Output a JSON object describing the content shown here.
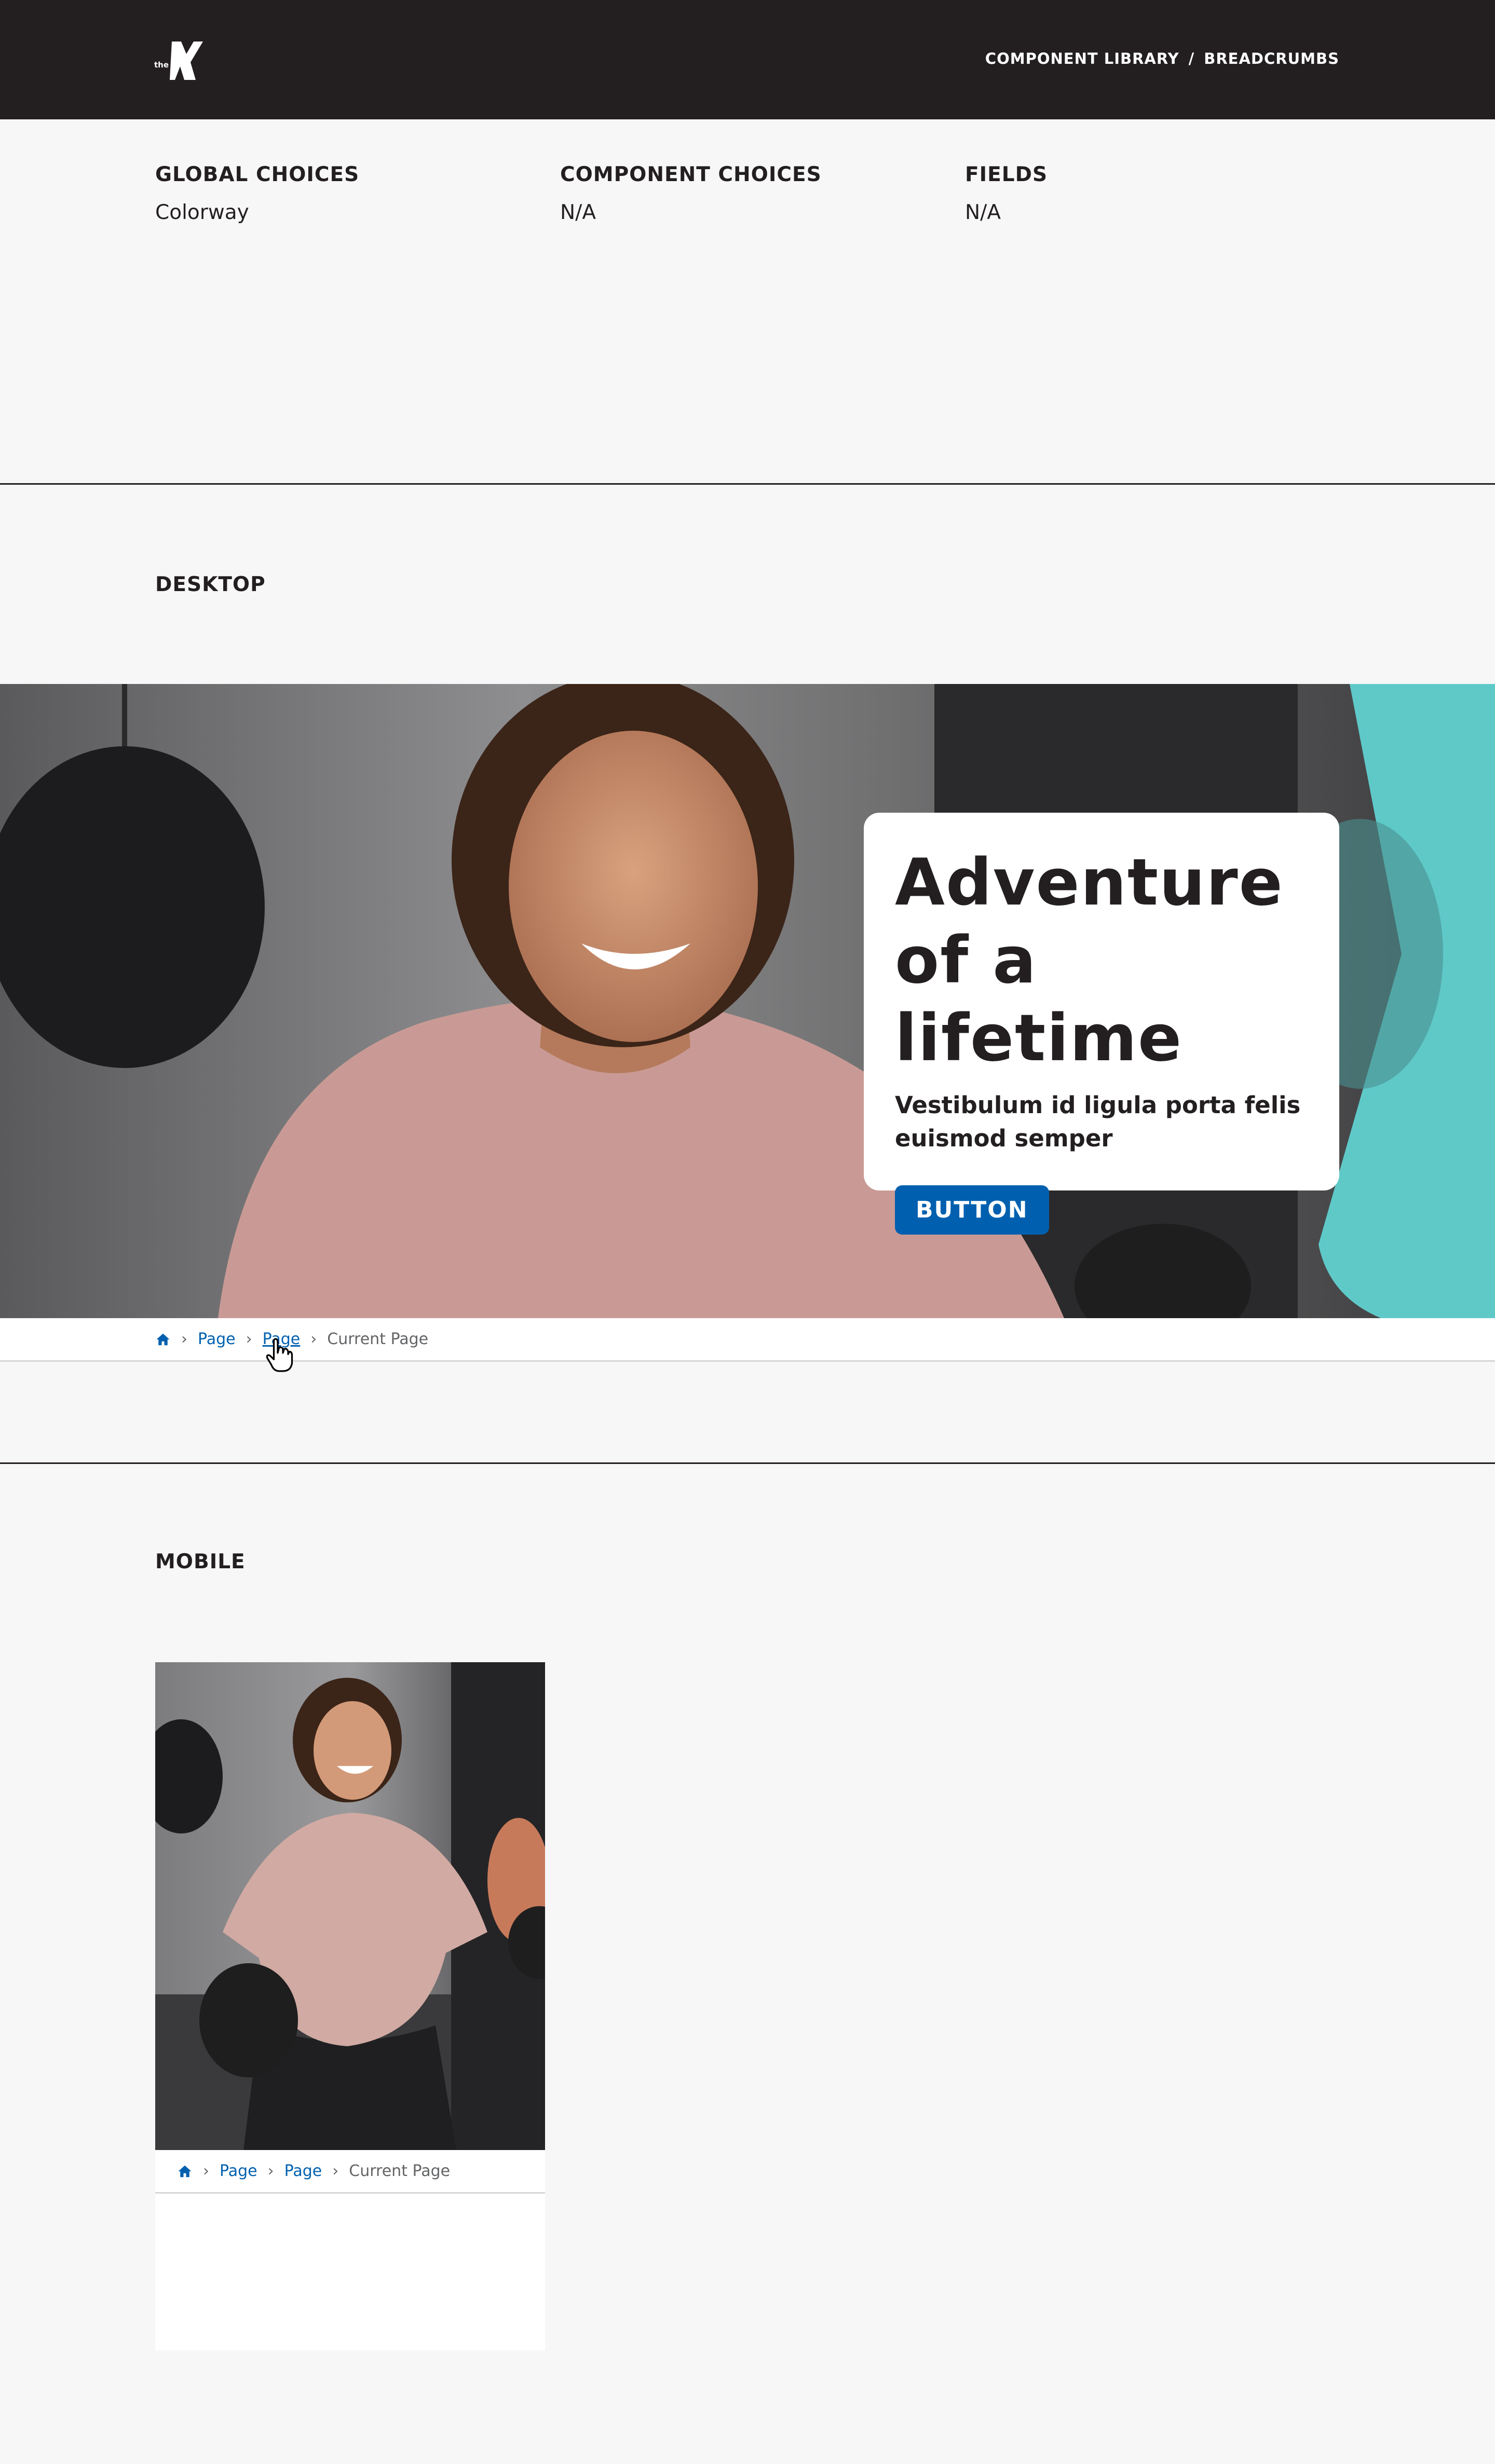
{
  "header": {
    "logo_text": "the",
    "nav": {
      "library": "COMPONENT LIBRARY",
      "separator": "/",
      "current": "BREADCRUMBS"
    }
  },
  "choices": {
    "global": {
      "heading": "GLOBAL CHOICES",
      "value": "Colorway"
    },
    "component": {
      "heading": "COMPONENT CHOICES",
      "value": "N/A"
    },
    "fields": {
      "heading": "FIELDS",
      "value": "N/A"
    }
  },
  "sections": {
    "desktop": "DESKTOP",
    "mobile": "MOBILE"
  },
  "hero": {
    "title": "Adventure of a lifetime",
    "subtitle": "Vestibulum id ligula porta felis euismod semper",
    "button": "BUTTON"
  },
  "breadcrumbs": {
    "home_icon": "home-icon",
    "separator": "›",
    "items": [
      "Page",
      "Page"
    ],
    "current": "Current Page"
  },
  "colors": {
    "header_bg": "#231f20",
    "page_bg": "#f7f7f7",
    "link": "#0060af",
    "button": "#0060af",
    "accent_teal": "#5fc9c8",
    "muted": "#636466"
  }
}
